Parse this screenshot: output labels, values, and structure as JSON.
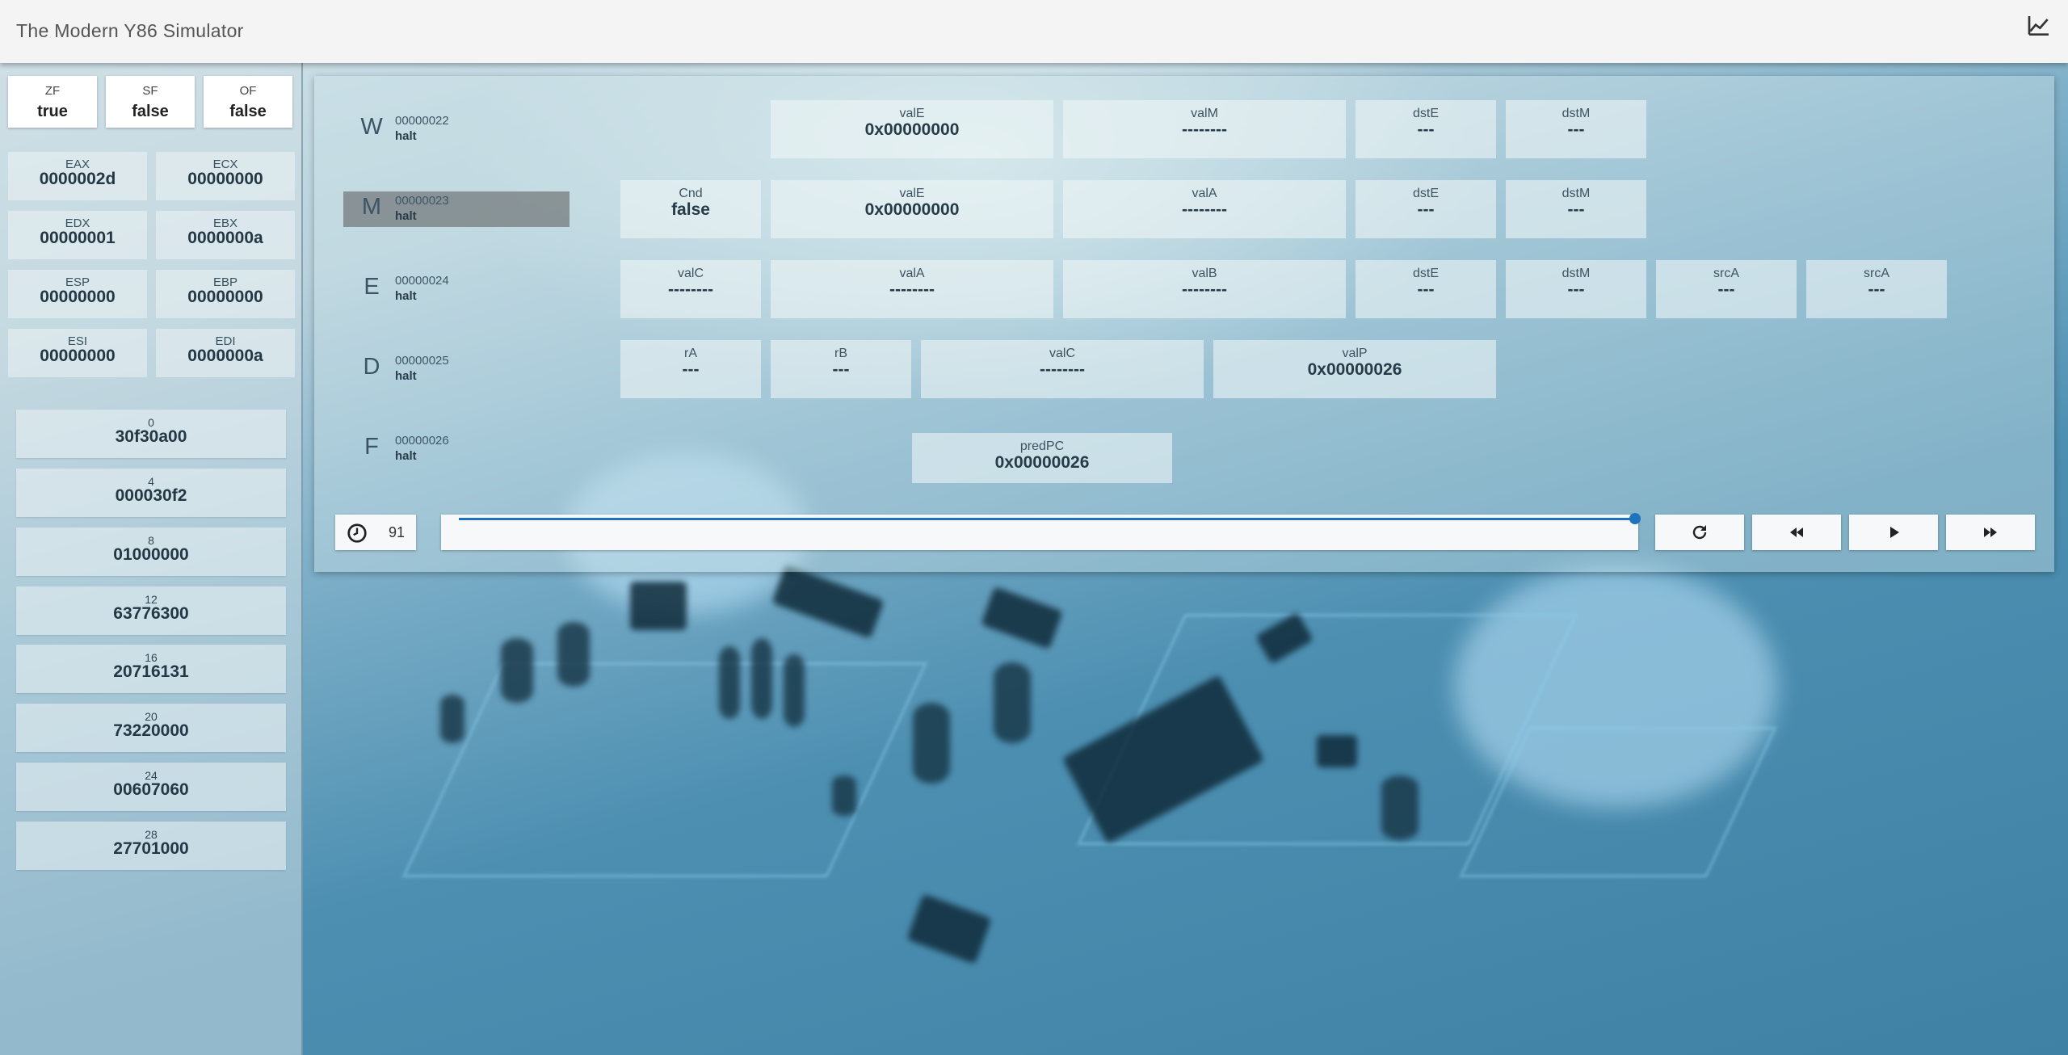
{
  "app": {
    "title": "The Modern Y86 Simulator"
  },
  "header": {
    "chart_icon": "chart-line-icon"
  },
  "flags": [
    {
      "name": "ZF",
      "value": "true"
    },
    {
      "name": "SF",
      "value": "false"
    },
    {
      "name": "OF",
      "value": "false"
    }
  ],
  "registers": [
    {
      "name": "EAX",
      "value": "0000002d"
    },
    {
      "name": "ECX",
      "value": "00000000"
    },
    {
      "name": "EDX",
      "value": "00000001"
    },
    {
      "name": "EBX",
      "value": "0000000a"
    },
    {
      "name": "ESP",
      "value": "00000000"
    },
    {
      "name": "EBP",
      "value": "00000000"
    },
    {
      "name": "ESI",
      "value": "00000000"
    },
    {
      "name": "EDI",
      "value": "0000000a"
    }
  ],
  "memory": [
    {
      "address": "0",
      "value": "30f30a00"
    },
    {
      "address": "4",
      "value": "000030f2"
    },
    {
      "address": "8",
      "value": "01000000"
    },
    {
      "address": "12",
      "value": "63776300"
    },
    {
      "address": "16",
      "value": "20716131"
    },
    {
      "address": "20",
      "value": "73220000"
    },
    {
      "address": "24",
      "value": "00607060"
    },
    {
      "address": "28",
      "value": "27701000"
    }
  ],
  "pipeline": {
    "W": {
      "letter": "W",
      "address": "00000022",
      "status": "halt",
      "fields": [
        {
          "label": "valE",
          "value": "0x00000000"
        },
        {
          "label": "valM",
          "value": "--------"
        },
        {
          "label": "dstE",
          "value": "---"
        },
        {
          "label": "dstM",
          "value": "---"
        }
      ]
    },
    "M": {
      "letter": "M",
      "address": "00000023",
      "status": "halt",
      "fields": [
        {
          "label": "Cnd",
          "value": "false"
        },
        {
          "label": "valE",
          "value": "0x00000000"
        },
        {
          "label": "valA",
          "value": "--------"
        },
        {
          "label": "dstE",
          "value": "---"
        },
        {
          "label": "dstM",
          "value": "---"
        }
      ]
    },
    "E": {
      "letter": "E",
      "address": "00000024",
      "status": "halt",
      "fields": [
        {
          "label": "valC",
          "value": "--------"
        },
        {
          "label": "valA",
          "value": "--------"
        },
        {
          "label": "valB",
          "value": "--------"
        },
        {
          "label": "dstE",
          "value": "---"
        },
        {
          "label": "dstM",
          "value": "---"
        },
        {
          "label": "srcA",
          "value": "---"
        },
        {
          "label": "srcA",
          "value": "---"
        }
      ]
    },
    "D": {
      "letter": "D",
      "address": "00000025",
      "status": "halt",
      "fields": [
        {
          "label": "rA",
          "value": "---"
        },
        {
          "label": "rB",
          "value": "---"
        },
        {
          "label": "valC",
          "value": "--------"
        },
        {
          "label": "valP",
          "value": "0x00000026"
        }
      ]
    },
    "F": {
      "letter": "F",
      "address": "00000026",
      "status": "halt",
      "fields": [
        {
          "label": "predPC",
          "value": "0x00000026"
        }
      ]
    }
  },
  "controls": {
    "cycle": "91",
    "progress": 1.0,
    "icons": {
      "clock": "clock-icon",
      "reset": "reset-icon",
      "back": "rewind-icon",
      "play": "play-icon",
      "forward": "fast-forward-icon"
    }
  },
  "colors": {
    "accent": "#1e73be",
    "header_bg": "#f4f4f4"
  }
}
